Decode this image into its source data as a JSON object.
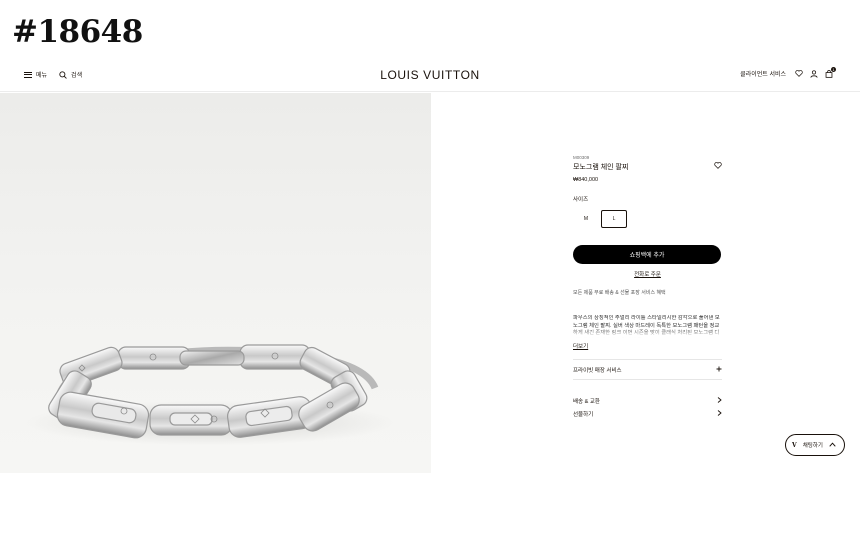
{
  "watermark": "#18648",
  "header": {
    "menu_label": "메뉴",
    "search_label": "검색",
    "brand": "LOUIS VUITTON",
    "service_label": "클라이언트 서비스",
    "bag_count": "1"
  },
  "product": {
    "sku": "M00309",
    "name": "모노그램 체인 팔찌",
    "price": "₩840,000",
    "size_label": "사이즈",
    "sizes": [
      "M",
      "L"
    ],
    "selected_size": "L",
    "add_to_bag": "쇼핑백에 추가",
    "order_by_phone": "전화로 주문",
    "perks": "모든 제품 무료 배송 & 선물 포장 서비스 혜택",
    "description": "파우스의 상징적인 주얼리 라이틀 스타일리시한 감각으로 풀어낸 모노그램 체인 팔찌. 실버 색상 마드레이 독특한 모노그램 패턴을 정교하게 새긴 존재한 링크 이번 시즌을 맞이 클래식 처리된 모노그램 디테일은 남성 액세서리 컬렉션 중",
    "read_more": "더보기",
    "boutique_service": "프라이빗 매장 서비스",
    "links": [
      "배송 & 교환",
      "선물하기"
    ]
  },
  "chat": {
    "label": "채팅하기"
  }
}
